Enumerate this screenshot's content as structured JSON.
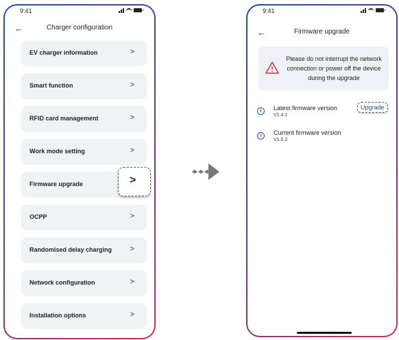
{
  "left_screen": {
    "status_time": "9:41",
    "title": "Charger configuration",
    "back_icon": "back-arrow-icon",
    "menu": [
      {
        "label": "EV charger information"
      },
      {
        "label": "Smart function"
      },
      {
        "label": "RFID card management"
      },
      {
        "label": "Work mode setting"
      },
      {
        "label": "Firmware upgrade"
      },
      {
        "label": "OCPP"
      },
      {
        "label": "Randomised delay charging"
      },
      {
        "label": "Network configuration"
      },
      {
        "label": "Installation options"
      }
    ],
    "chevron": ">"
  },
  "right_screen": {
    "status_time": "9:41",
    "title": "Firmware upgrade",
    "warning_text": "Please do not interrupt the network connection or power off the device during the upgrade",
    "latest_label": "Latest firmware version",
    "latest_version": "V1.4.1",
    "upgrade_label": "Upgrade",
    "current_label": "Current firmware version",
    "current_version": "V1.0.2",
    "info_glyph": "i"
  },
  "colors": {
    "accent_blue": "#1e4fa8",
    "accent_red": "#d12c55",
    "warning_red": "#d12c35",
    "card_bg": "#f0f3f6"
  }
}
